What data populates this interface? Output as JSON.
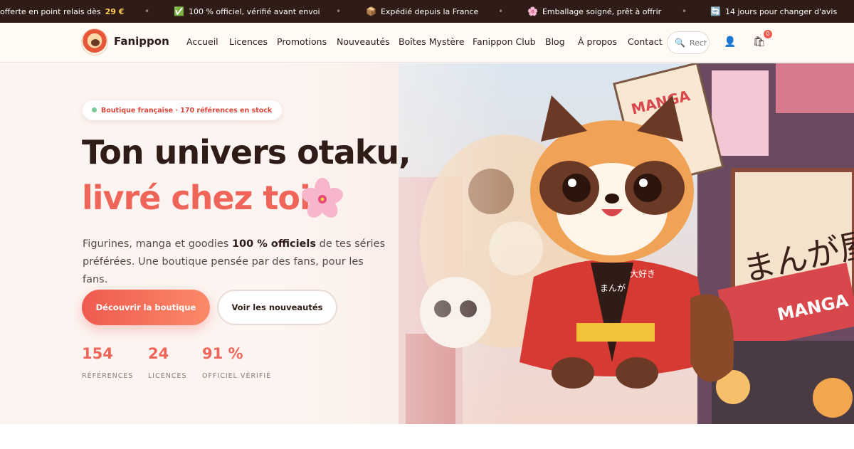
{
  "announcements": [
    {
      "icon": "",
      "text": "offerte en point relais dès",
      "price": "29 €"
    },
    {
      "icon": "✅",
      "text": "100 % officiel, vérifié avant envoi"
    },
    {
      "icon": "📦",
      "text": "Expédié depuis la France"
    },
    {
      "icon": "🌸",
      "text": "Emballage soigné, prêt à offrir"
    },
    {
      "icon": "🔄",
      "text": "14 jours pour changer d'avis"
    }
  ],
  "separator": "•",
  "header": {
    "brand": "Fanippon",
    "nav": [
      "Accueil",
      "Licences",
      "Promotions",
      "Nouveautés",
      "Boîtes Mystère",
      "Fanippon Club",
      "Blog",
      "À propos",
      "Contact"
    ],
    "search_placeholder": "Rechercher",
    "cart_count": "0"
  },
  "hero": {
    "badge": "Boutique française · 170 références en stock",
    "title_line1": "Ton univers otaku,",
    "title_line2": "livré chez toi",
    "lead_before": "Figurines, manga et goodies ",
    "lead_bold": "100 % officiels",
    "lead_after": " de tes séries préférées. Une boutique pensée par des fans, pour les fans.",
    "cta_primary": "Découvrir la boutique",
    "cta_secondary": "Voir les nouveautés",
    "stats": [
      {
        "value": "154",
        "label": "RÉFÉRENCES"
      },
      {
        "value": "24",
        "label": "LICENCES"
      },
      {
        "value": "91 %",
        "label": "OFFICIEL VÉRIFIÉ"
      }
    ],
    "art": {
      "shop_sign": "まんが屋",
      "manga_banner": "MANGA",
      "poster": "MANGA",
      "happi": "まんが",
      "happi2": "大好き"
    }
  },
  "colors": {
    "accent": "#f0655a",
    "dark": "#2f1c17",
    "ticker_bg": "#2f1c17"
  }
}
